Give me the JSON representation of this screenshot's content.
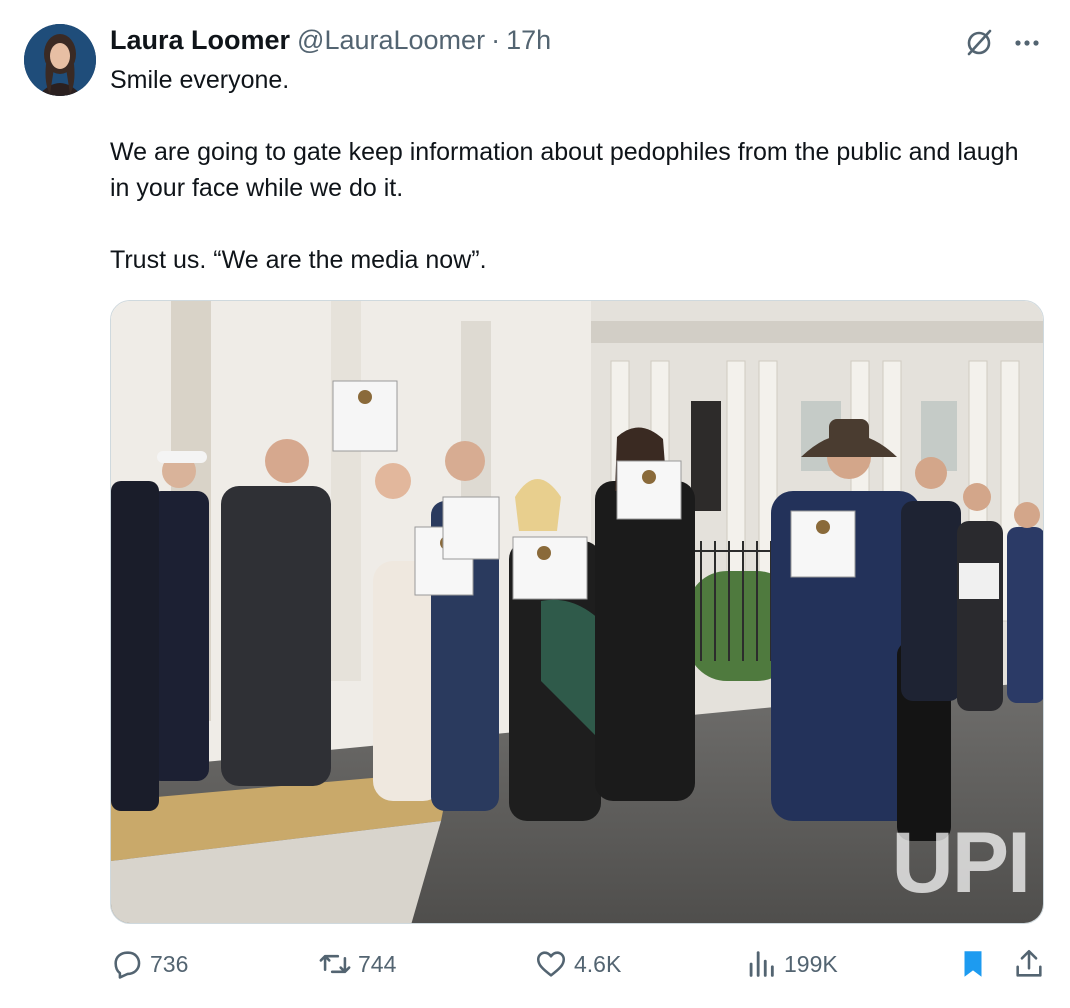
{
  "author": {
    "name": "Laura Loomer",
    "handle": "@LauraLoomer",
    "separator": "·",
    "time": "17h"
  },
  "tweet": {
    "paragraphs": [
      "Smile everyone.",
      "We are going to gate keep information about pedophiles from the public and laugh in your face while we do it.",
      "Trust us. “We are the media now”."
    ]
  },
  "media": {
    "watermark": "UPI"
  },
  "actions": {
    "replies": "736",
    "reposts": "744",
    "likes": "4.6K",
    "views": "199K"
  },
  "icons": {
    "avatar": "avatar",
    "grok": "grok-icon",
    "more": "more-icon",
    "reply": "reply-icon",
    "retweet": "retweet-icon",
    "like": "heart-icon",
    "views": "views-icon",
    "bookmark": "bookmark-icon",
    "share": "share-icon"
  },
  "colors": {
    "text": "#0f1419",
    "secondary": "#536471",
    "bookmark_blue": "#1d9bf0"
  }
}
